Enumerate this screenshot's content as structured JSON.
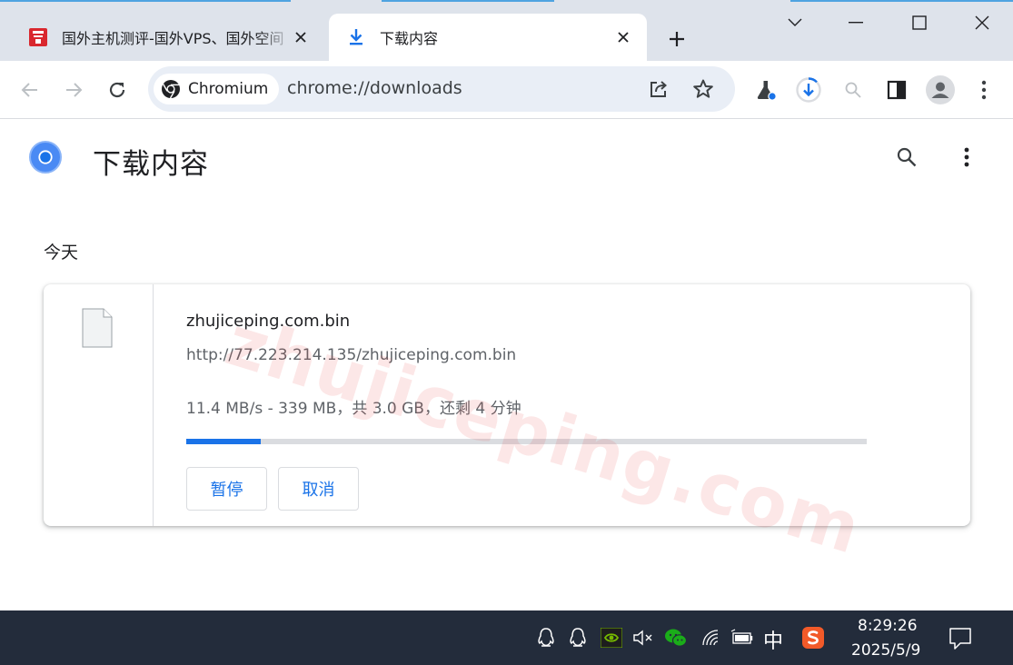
{
  "tabs": [
    {
      "title": "国外主机测评-国外VPS、国外空间",
      "favicon": "site-favicon"
    },
    {
      "title": "下载内容",
      "favicon": "download-icon"
    }
  ],
  "omnibox": {
    "chip_label": "Chromium",
    "url": "chrome://downloads"
  },
  "page": {
    "title": "下载内容",
    "section_date": "今天"
  },
  "download": {
    "file_name": "zhujiceping.com.bin",
    "url": "http://77.223.214.135/zhujiceping.com.bin",
    "status": "11.4 MB/s - 339 MB，共 3.0 GB，还剩 4 分钟",
    "progress_fraction": 0.11,
    "pause_label": "暂停",
    "cancel_label": "取消"
  },
  "watermark": "zhujiceping.com",
  "taskbar": {
    "ime": "中",
    "time": "8:29:26",
    "date": "2025/5/9"
  },
  "colors": {
    "accent": "#1a73e8",
    "tabstrip": "#dee3eb",
    "omnibox": "#e9eef6",
    "taskbar": "#232c3b"
  }
}
